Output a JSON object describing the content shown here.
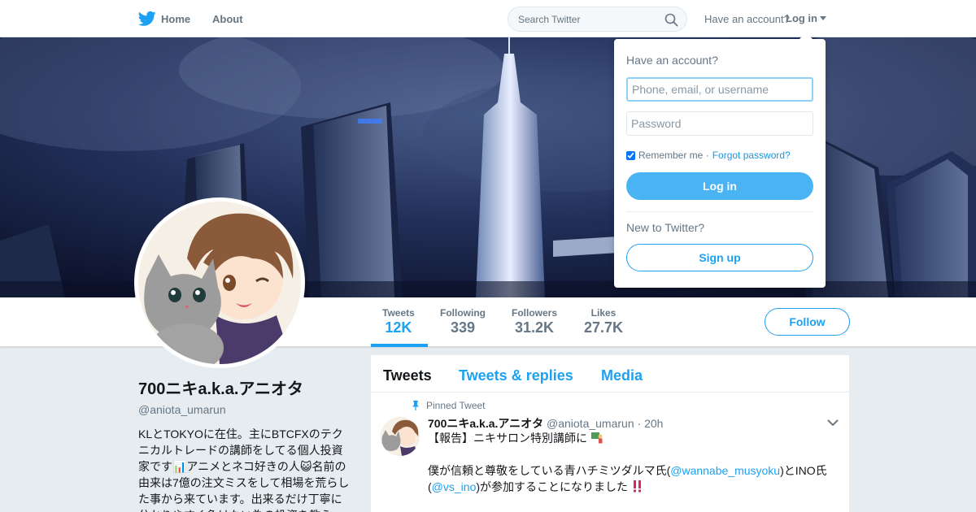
{
  "nav": {
    "home_label": "Home",
    "about_label": "About",
    "search_placeholder": "Search Twitter",
    "have_account": "Have an account?",
    "login_label": "Log in"
  },
  "profile": {
    "name": "700ニキa.k.a.アニオタ",
    "handle": "@aniota_umarun",
    "bio": "KLとTOKYOに在住。主にBTCFXのテクニカルトレードの講師をしてる個人投資家です📊アニメとネコ好きの人😺名前の由来は7億の注文ミスをして相場を荒らした事から来ています。出来るだけ丁寧に分かりやすく負けない為の投資を教え"
  },
  "stats": [
    {
      "label": "Tweets",
      "value": "12K"
    },
    {
      "label": "Following",
      "value": "339"
    },
    {
      "label": "Followers",
      "value": "31.2K"
    },
    {
      "label": "Likes",
      "value": "27.7K"
    }
  ],
  "follow_label": "Follow",
  "timeline": {
    "tabs": [
      "Tweets",
      "Tweets & replies",
      "Media"
    ],
    "pinned_label": "Pinned Tweet",
    "tweet": {
      "name": "700ニキa.k.a.アニオタ",
      "handle": "@aniota_umarun",
      "time": "· 20h",
      "line1": "【報告】ニキサロン特別講師に",
      "line2_a": "僕が信頼と尊敬をしている青ハチミツダルマ氏(",
      "line2_link": "@wannabe_musyoku",
      "line2_b": ")とINO氏",
      "line3_a": "(",
      "line3_link": "@vs_ino",
      "line3_b": ")が参加することになりました"
    }
  },
  "login_dropdown": {
    "title": "Have an account?",
    "username_placeholder": "Phone, email, or username",
    "password_placeholder": "Password",
    "remember_label": "Remember me ·",
    "forgot_label": "Forgot password?",
    "login_button": "Log in",
    "new_label": "New to Twitter?",
    "signup_button": "Sign up"
  },
  "colors": {
    "accent": "#1da1f2",
    "login_button": "#4ab3f4",
    "background": "#e6ecf0"
  },
  "icons": [
    "twitter-bird-icon",
    "search-icon",
    "caret-down-icon",
    "pin-icon",
    "chevron-down-icon"
  ]
}
